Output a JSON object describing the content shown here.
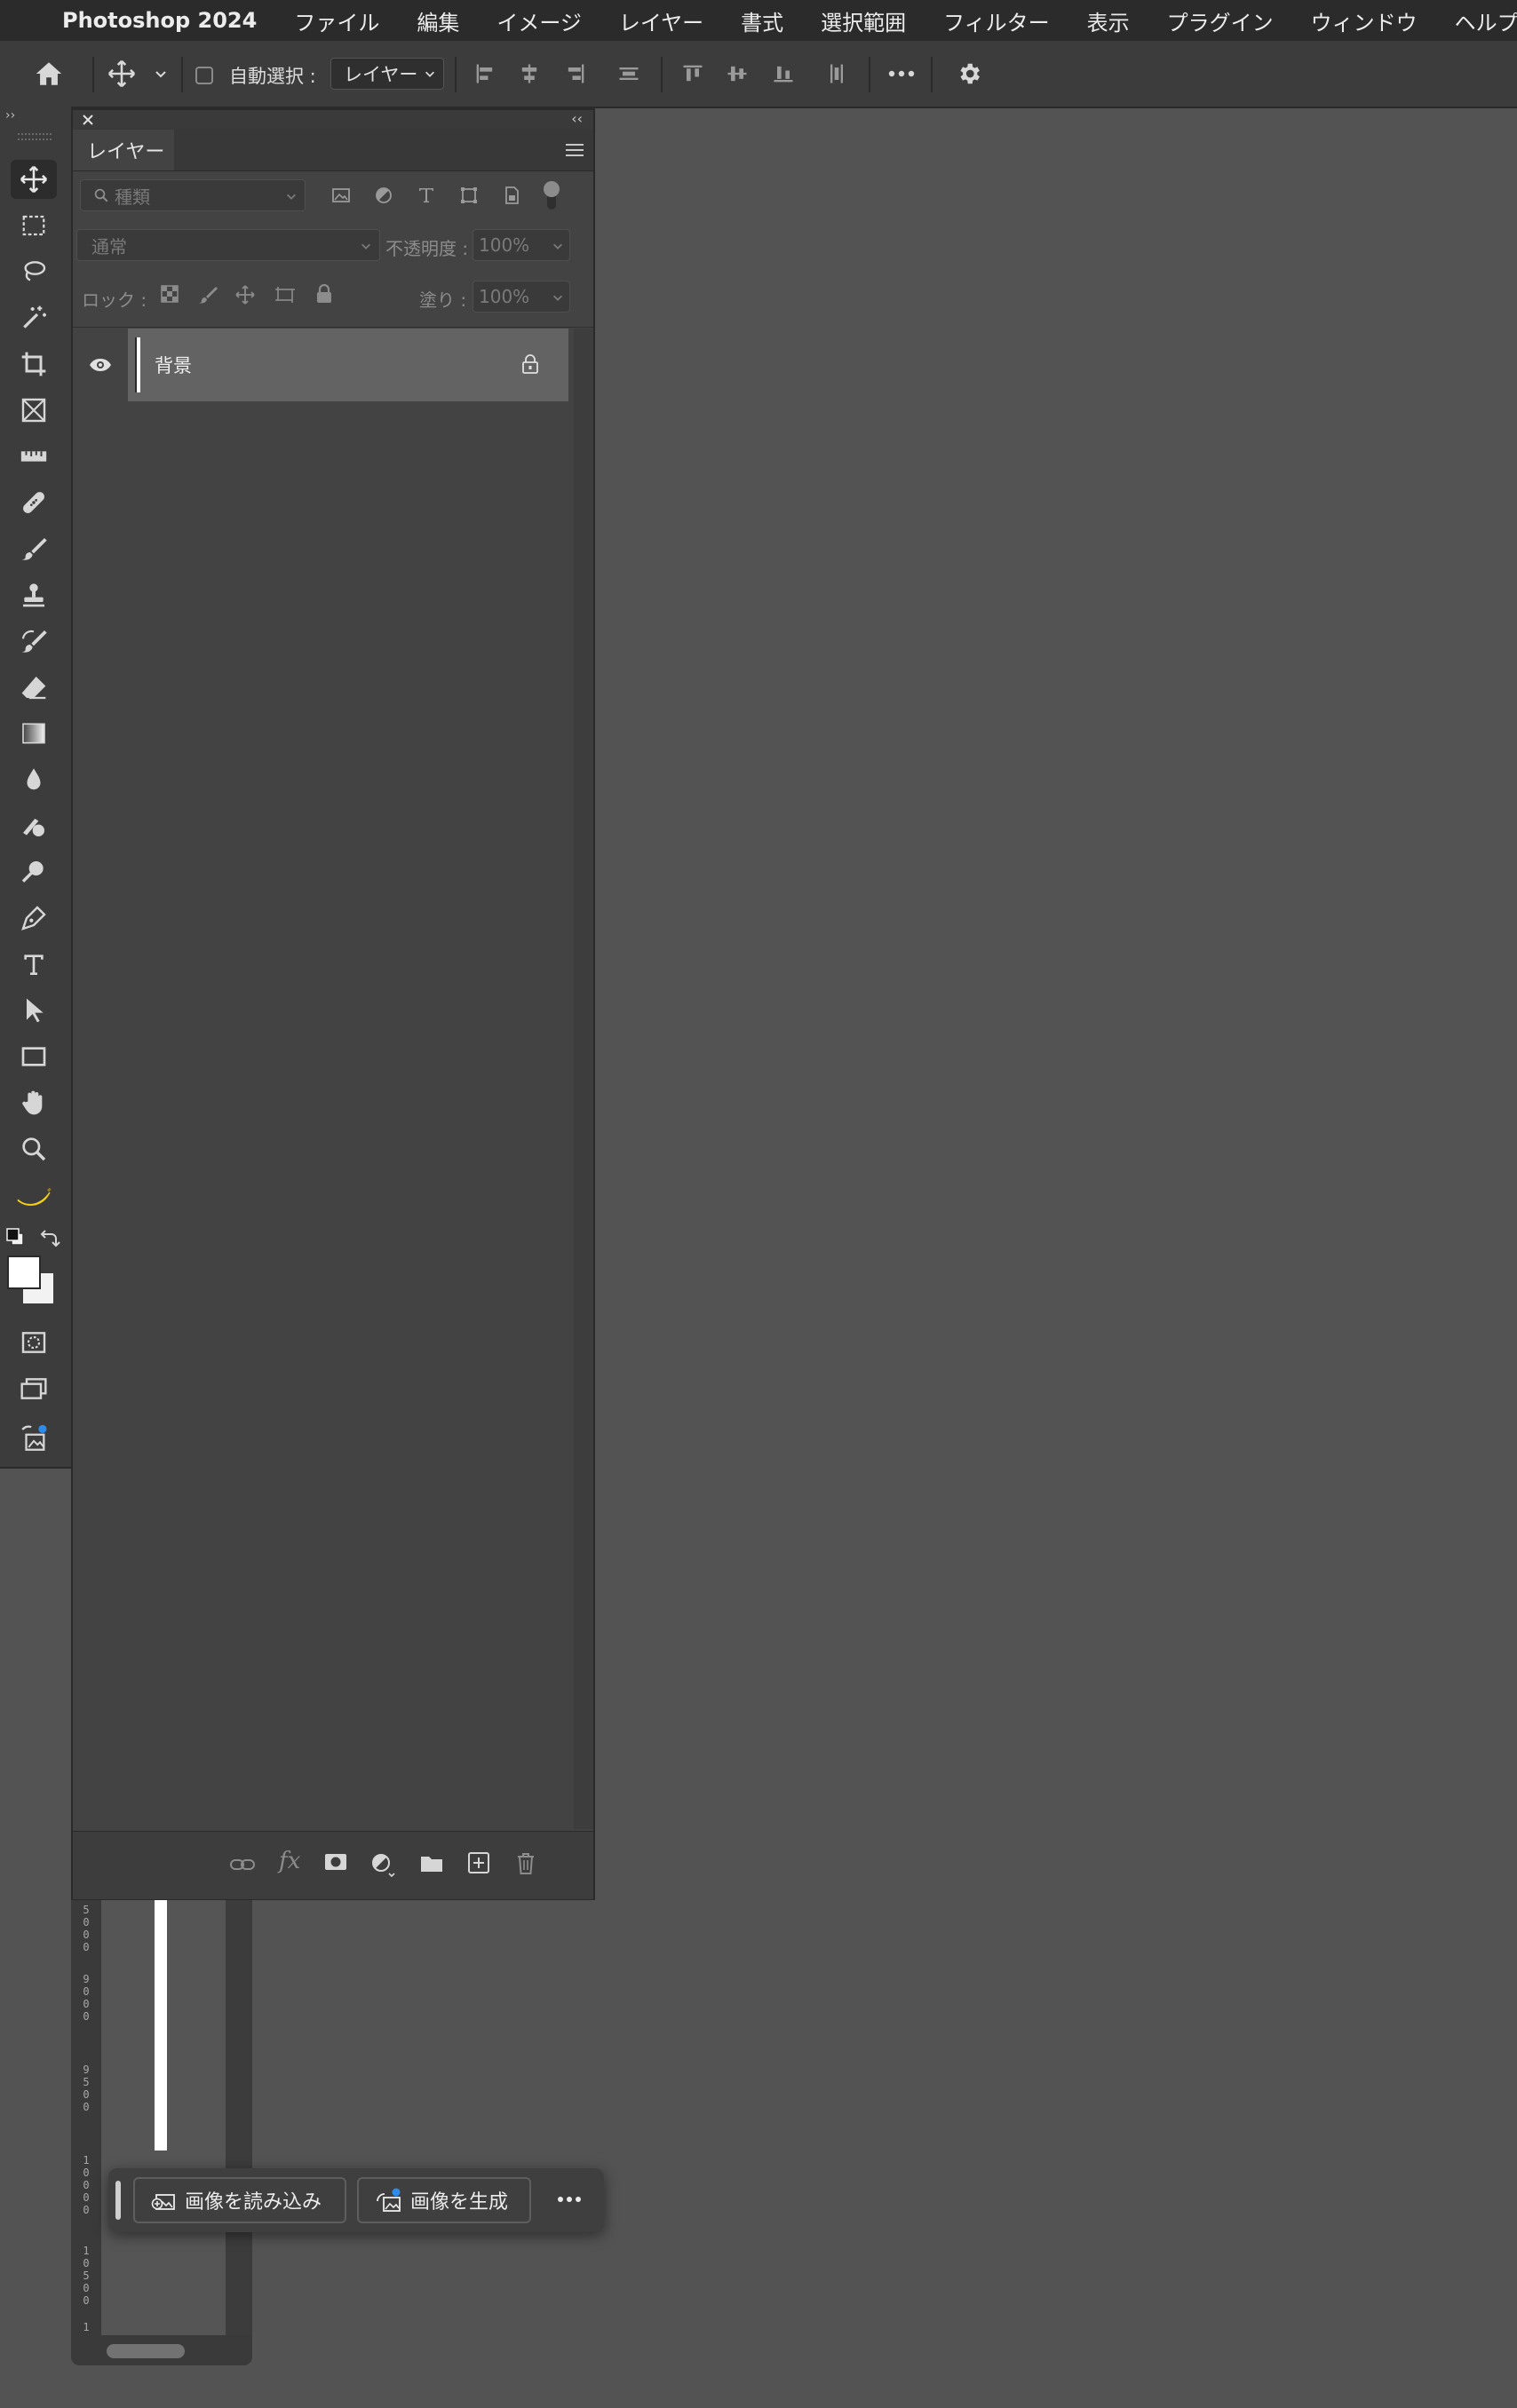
{
  "menubar": {
    "app_name": "Photoshop 2024",
    "items": [
      "ファイル",
      "編集",
      "イメージ",
      "レイヤー",
      "書式",
      "選択範囲",
      "フィルター",
      "表示",
      "プラグイン",
      "ウィンドウ",
      "ヘルプ"
    ]
  },
  "options_bar": {
    "auto_select_label": "自動選択 :",
    "auto_select_checked": false,
    "target_value": "レイヤー"
  },
  "layers_panel": {
    "tab_label": "レイヤー",
    "filter_placeholder": "種類",
    "blend_mode": "通常",
    "opacity_label": "不透明度 :",
    "opacity_value": "100%",
    "lock_label": "ロック :",
    "fill_label": "塗り :",
    "fill_value": "100%",
    "layers": [
      {
        "name": "背景",
        "visible": true,
        "locked": true
      }
    ]
  },
  "ruler": {
    "labels": [
      "5000",
      "9000",
      "9500",
      "10000",
      "10500",
      "1"
    ]
  },
  "task_bar": {
    "import_label": "画像を読み込み",
    "generate_label": "画像を生成"
  },
  "colors": {
    "menubar_bg": "#2b2b2b",
    "panel_bg": "#434343",
    "workspace_bg": "#535353",
    "selected_row": "#636363",
    "banana": "#f2d019",
    "badge_blue": "#2d8ceb"
  }
}
